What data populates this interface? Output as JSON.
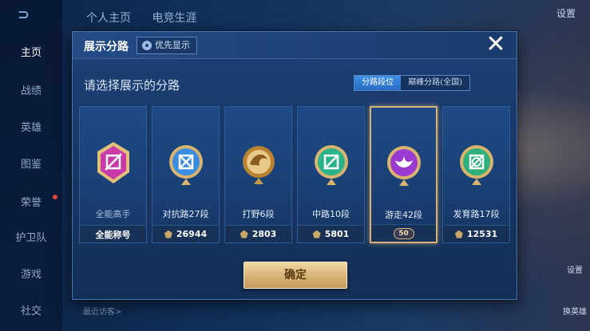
{
  "left_nav": {
    "items": [
      {
        "label": "主页",
        "active": true
      },
      {
        "label": "战绩",
        "active": false
      },
      {
        "label": "英雄",
        "active": false
      },
      {
        "label": "图鉴",
        "active": false
      },
      {
        "label": "荣誉",
        "active": false
      },
      {
        "label": "护卫队",
        "active": false
      },
      {
        "label": "游戏",
        "active": false
      },
      {
        "label": "社交",
        "active": false
      }
    ]
  },
  "top_tabs": [
    "个人主页",
    "电竞生涯"
  ],
  "top_right": {
    "settings_label": "设置"
  },
  "side_hints": [
    "设置",
    "换英雄"
  ],
  "bottom_hint": "最近访客>",
  "modal": {
    "title": "展示分路",
    "pref_button": "优先显示",
    "subtitle": "请选择展示的分路",
    "seg_tabs": [
      {
        "label": "分路段位",
        "active": true
      },
      {
        "label": "巅峰分路(全国)",
        "active": false
      }
    ],
    "cards": [
      {
        "label": "全能高手",
        "footer": "全能称号",
        "points_icon": false,
        "selected": false,
        "badge_color": "#c83aa8"
      },
      {
        "label": "对抗路27段",
        "footer": "26944",
        "points_icon": true,
        "selected": false,
        "badge_color": "#3a8ce0"
      },
      {
        "label": "打野6段",
        "footer": "2803",
        "points_icon": true,
        "selected": false,
        "badge_color": "#c98a2e"
      },
      {
        "label": "中路10段",
        "footer": "5801",
        "points_icon": true,
        "selected": false,
        "badge_color": "#2bb38a"
      },
      {
        "label": "游走42段",
        "footer": "50",
        "points_icon": false,
        "selected": true,
        "badge_color": "#9a3ad0"
      },
      {
        "label": "发育路17段",
        "footer": "12531",
        "points_icon": true,
        "selected": false,
        "badge_color": "#2fb07a"
      }
    ],
    "confirm_label": "确定"
  }
}
